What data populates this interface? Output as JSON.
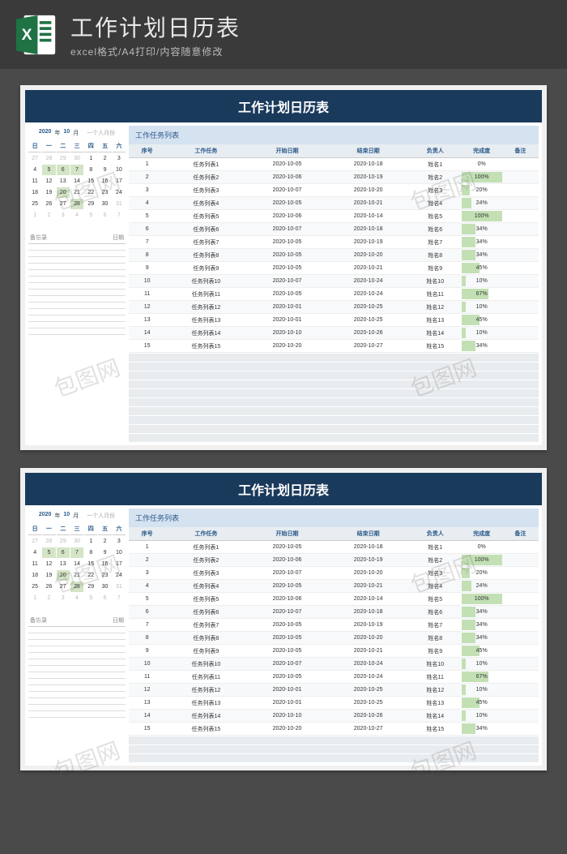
{
  "header": {
    "title": "工作计划日历表",
    "subtitle": "excel格式/A4打印/内容随意修改"
  },
  "sheet": {
    "title": "工作计划日历表",
    "calendar": {
      "year": "2020",
      "year_lbl": "年",
      "month": "10",
      "month_lbl": "月",
      "note": "一个人月份",
      "day_headers": [
        "日",
        "一",
        "二",
        "三",
        "四",
        "五",
        "六"
      ],
      "days": [
        {
          "n": "27",
          "o": true
        },
        {
          "n": "28",
          "o": true
        },
        {
          "n": "29",
          "o": true
        },
        {
          "n": "30",
          "o": true
        },
        {
          "n": "1"
        },
        {
          "n": "2"
        },
        {
          "n": "3"
        },
        {
          "n": "4"
        },
        {
          "n": "5",
          "hl": true
        },
        {
          "n": "6",
          "hl": true
        },
        {
          "n": "7",
          "hl": true
        },
        {
          "n": "8"
        },
        {
          "n": "9"
        },
        {
          "n": "10"
        },
        {
          "n": "11"
        },
        {
          "n": "12"
        },
        {
          "n": "13"
        },
        {
          "n": "14"
        },
        {
          "n": "15"
        },
        {
          "n": "16"
        },
        {
          "n": "17"
        },
        {
          "n": "18"
        },
        {
          "n": "19"
        },
        {
          "n": "20",
          "hl": true
        },
        {
          "n": "21"
        },
        {
          "n": "22"
        },
        {
          "n": "23"
        },
        {
          "n": "24"
        },
        {
          "n": "25"
        },
        {
          "n": "26"
        },
        {
          "n": "27"
        },
        {
          "n": "28",
          "hl": true
        },
        {
          "n": "29"
        },
        {
          "n": "30"
        },
        {
          "n": "31",
          "o": true
        },
        {
          "n": "1",
          "o": true
        },
        {
          "n": "2",
          "o": true
        },
        {
          "n": "3",
          "o": true
        },
        {
          "n": "4",
          "o": true
        },
        {
          "n": "5",
          "o": true
        },
        {
          "n": "6",
          "o": true
        },
        {
          "n": "7",
          "o": true
        }
      ],
      "memo_lbl": "备忘录",
      "memo_date": "日期"
    },
    "task_list": {
      "title": "工作任务列表",
      "headers": [
        "序号",
        "工作任务",
        "开始日期",
        "结束日期",
        "负责人",
        "完成度",
        "备注"
      ],
      "rows": [
        {
          "no": "1",
          "task": "任务列表1",
          "start": "2020-10-05",
          "end": "2020-10-18",
          "owner": "姓名1",
          "pct": 0
        },
        {
          "no": "2",
          "task": "任务列表2",
          "start": "2020-10-06",
          "end": "2020-10-19",
          "owner": "姓名2",
          "pct": 100
        },
        {
          "no": "3",
          "task": "任务列表3",
          "start": "2020-10-07",
          "end": "2020-10-20",
          "owner": "姓名3",
          "pct": 20
        },
        {
          "no": "4",
          "task": "任务列表4",
          "start": "2020-10-05",
          "end": "2020-10-21",
          "owner": "姓名4",
          "pct": 24
        },
        {
          "no": "5",
          "task": "任务列表5",
          "start": "2020-10-06",
          "end": "2020-10-14",
          "owner": "姓名5",
          "pct": 100
        },
        {
          "no": "6",
          "task": "任务列表6",
          "start": "2020-10-07",
          "end": "2020-10-18",
          "owner": "姓名6",
          "pct": 34
        },
        {
          "no": "7",
          "task": "任务列表7",
          "start": "2020-10-05",
          "end": "2020-10-19",
          "owner": "姓名7",
          "pct": 34
        },
        {
          "no": "8",
          "task": "任务列表8",
          "start": "2020-10-05",
          "end": "2020-10-20",
          "owner": "姓名8",
          "pct": 34
        },
        {
          "no": "9",
          "task": "任务列表9",
          "start": "2020-10-05",
          "end": "2020-10-21",
          "owner": "姓名9",
          "pct": 45
        },
        {
          "no": "10",
          "task": "任务列表10",
          "start": "2020-10-07",
          "end": "2020-10-24",
          "owner": "姓名10",
          "pct": 10
        },
        {
          "no": "11",
          "task": "任务列表11",
          "start": "2020-10-05",
          "end": "2020-10-24",
          "owner": "姓名11",
          "pct": 67
        },
        {
          "no": "12",
          "task": "任务列表12",
          "start": "2020-10-01",
          "end": "2020-10-25",
          "owner": "姓名12",
          "pct": 10
        },
        {
          "no": "13",
          "task": "任务列表13",
          "start": "2020-10-01",
          "end": "2020-10-25",
          "owner": "姓名13",
          "pct": 45
        },
        {
          "no": "14",
          "task": "任务列表14",
          "start": "2020-10-10",
          "end": "2020-10-26",
          "owner": "姓名14",
          "pct": 10
        },
        {
          "no": "15",
          "task": "任务列表15",
          "start": "2020-10-20",
          "end": "2020-10-27",
          "owner": "姓名15",
          "pct": 34
        }
      ]
    }
  },
  "watermark": "包图网"
}
